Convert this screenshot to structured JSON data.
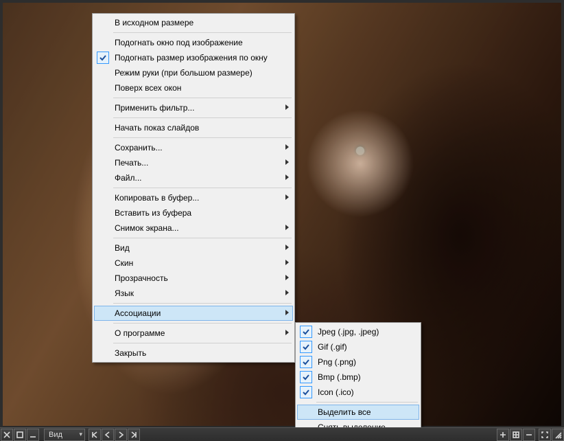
{
  "toolbar": {
    "view_dropdown": "Вид"
  },
  "menu": {
    "original_size": "В исходном размере",
    "fit_window_to_image": "Подогнать окно под изображение",
    "fit_image_to_window": "Подогнать размер изображения по окну",
    "hand_mode": "Режим руки (при большом размере)",
    "always_on_top": "Поверх всех окон",
    "apply_filter": "Применить фильтр...",
    "start_slideshow": "Начать показ слайдов",
    "save": "Сохранить...",
    "print": "Печать...",
    "file": "Файл...",
    "copy_to_buffer": "Копировать в буфер...",
    "paste_from_buffer": "Вставить из буфера",
    "screenshot": "Снимок экрана...",
    "view": "Вид",
    "skin": "Скин",
    "transparency": "Прозрачность",
    "language": "Язык",
    "associations": "Ассоциации",
    "about": "О программе",
    "close": "Закрыть"
  },
  "submenu": {
    "jpeg": "Jpeg (.jpg, .jpeg)",
    "gif": "Gif (.gif)",
    "png": "Png (.png)",
    "bmp": "Bmp (.bmp)",
    "icon": "Icon (.ico)",
    "select_all": "Выделить все",
    "deselect_all": "Снять выделение"
  }
}
